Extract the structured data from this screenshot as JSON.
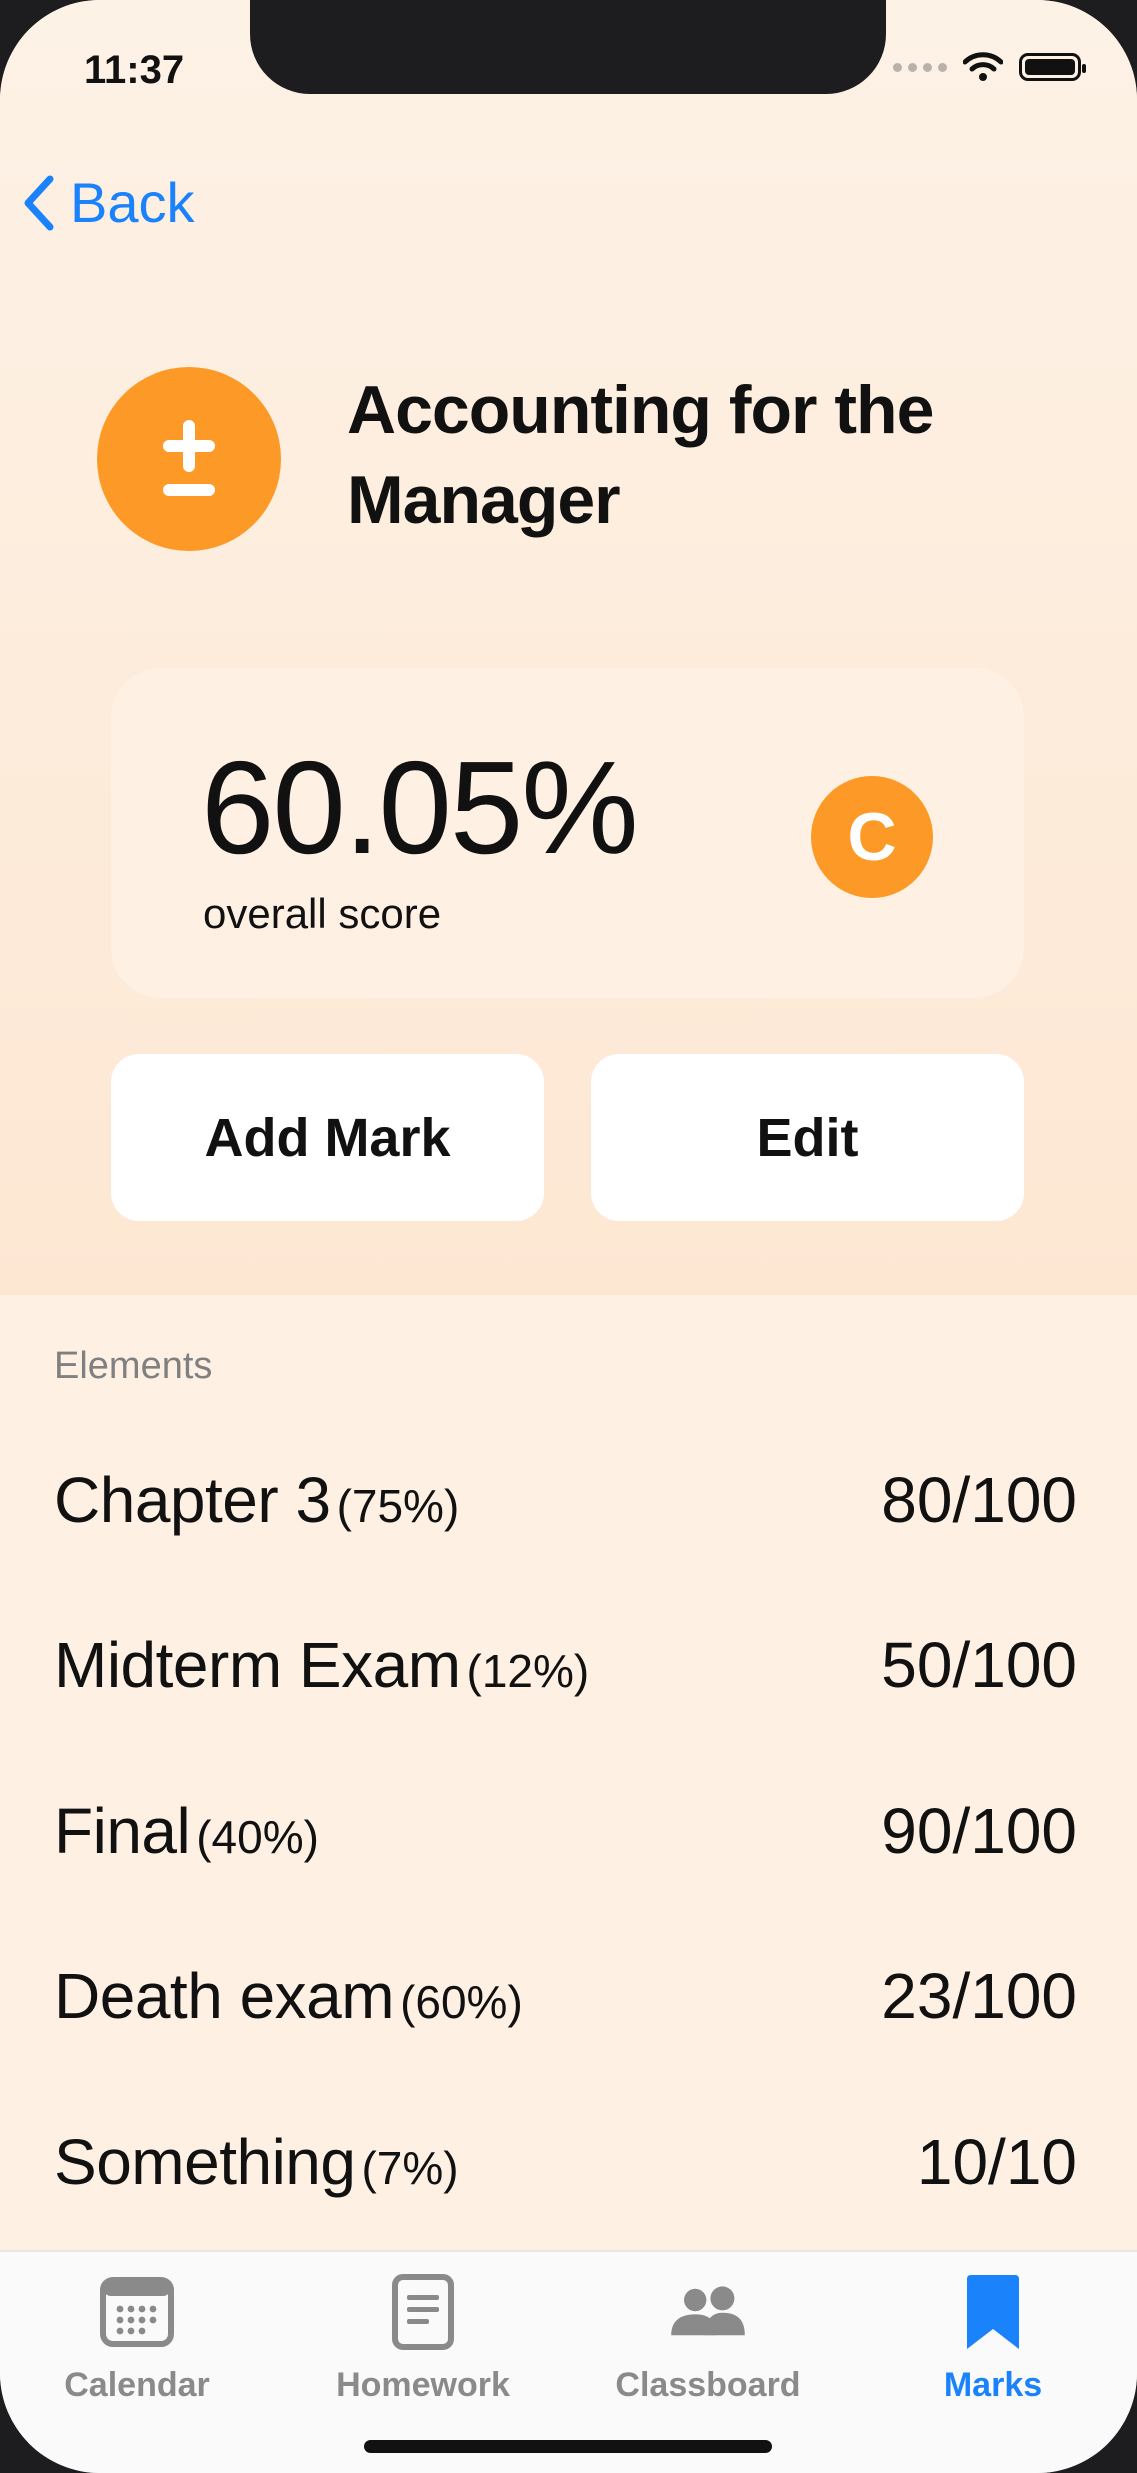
{
  "status_bar": {
    "time": "11:37"
  },
  "nav": {
    "back_label": "Back"
  },
  "subject": {
    "title": "Accounting for the Manager",
    "icon": "plus-minus-icon"
  },
  "score": {
    "value": "60.05%",
    "label": "overall score",
    "grade": "C"
  },
  "actions": {
    "add_mark_label": "Add Mark",
    "edit_label": "Edit"
  },
  "elements": {
    "header": "Elements",
    "items": [
      {
        "name": "Chapter 3",
        "weight": "(75%)",
        "score": "80/100"
      },
      {
        "name": "Midterm Exam",
        "weight": "(12%)",
        "score": "50/100"
      },
      {
        "name": "Final",
        "weight": "(40%)",
        "score": "90/100"
      },
      {
        "name": "Death exam",
        "weight": "(60%)",
        "score": "23/100"
      },
      {
        "name": "Something",
        "weight": "(7%)",
        "score": "10/10"
      }
    ]
  },
  "tabs": [
    {
      "label": "Calendar",
      "icon": "calendar-icon",
      "active": false
    },
    {
      "label": "Homework",
      "icon": "document-icon",
      "active": false
    },
    {
      "label": "Classboard",
      "icon": "people-icon",
      "active": false
    },
    {
      "label": "Marks",
      "icon": "bookmark-icon",
      "active": true
    }
  ],
  "colors": {
    "accent": "#fd9a27",
    "link": "#1a82fb",
    "background": "#fde8d4"
  }
}
